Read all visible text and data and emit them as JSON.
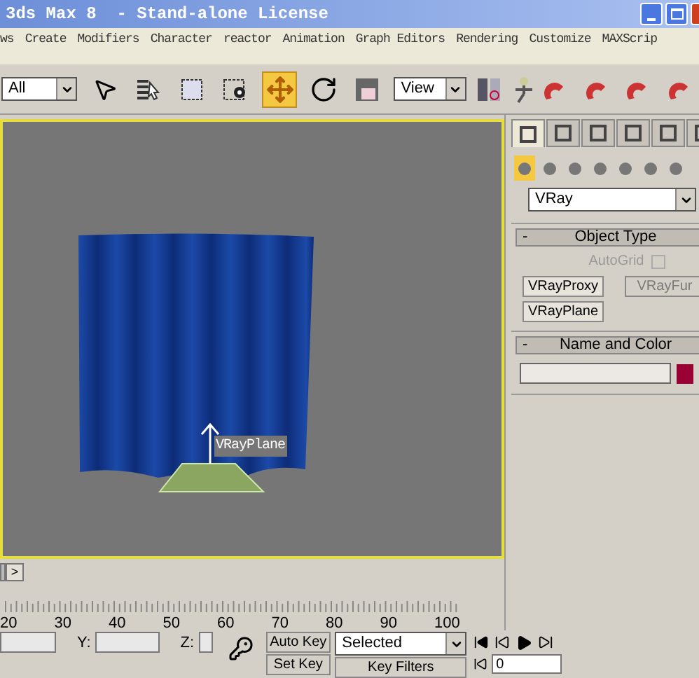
{
  "window": {
    "title": "3ds Max 8  - Stand-alone License"
  },
  "menu": [
    "ws",
    "Create",
    "Modifiers",
    "Character",
    "reactor",
    "Animation",
    "Graph Editors",
    "Rendering",
    "Customize",
    "MAXScrip"
  ],
  "toolbar": {
    "selection_filter": "All",
    "reference_coord": "View"
  },
  "tools": [
    {
      "kind": "select",
      "selected": false
    },
    {
      "kind": "select-by-name",
      "selected": false
    },
    {
      "kind": "region",
      "selected": false
    },
    {
      "kind": "window",
      "selected": false
    },
    {
      "kind": "move",
      "selected": true
    },
    {
      "kind": "rotate",
      "selected": false
    },
    {
      "kind": "scale",
      "selected": false
    }
  ],
  "command_panel": {
    "tabs": [
      {
        "selected": true
      },
      {
        "selected": false
      },
      {
        "selected": false
      },
      {
        "selected": false
      },
      {
        "selected": false
      },
      {
        "selected": false
      }
    ],
    "categories": [
      {
        "selected": true
      },
      {
        "selected": false
      },
      {
        "selected": false
      },
      {
        "selected": false
      },
      {
        "selected": false
      },
      {
        "selected": false
      },
      {
        "selected": false
      }
    ],
    "category": "VRay",
    "object_type": {
      "toggle": "-",
      "title": "Object Type",
      "autogrid": {
        "label": "AutoGrid",
        "checked": false,
        "disabled": true
      },
      "buttons": [
        {
          "label": "VRayProxy",
          "disabled": false
        },
        {
          "label": "VRayFur",
          "disabled": true
        },
        {
          "label": "VRayPlane",
          "disabled": false
        }
      ]
    },
    "name_and_color": {
      "toggle": "-",
      "title": "Name and Color",
      "color": "#990033"
    }
  },
  "viewport": {
    "active": true,
    "object_label": "VRayPlane"
  },
  "timeline": {
    "next": ">",
    "ticks": [
      "20",
      "30",
      "40",
      "50",
      "60",
      "70",
      "80",
      "90",
      "100"
    ]
  },
  "status": {
    "y_label": "Y:",
    "z_label": "Z:",
    "auto_key": "Auto Key",
    "key_mode": "Selected",
    "set_key": "Set Key",
    "key_filters": "Key Filters",
    "frame": "0"
  }
}
